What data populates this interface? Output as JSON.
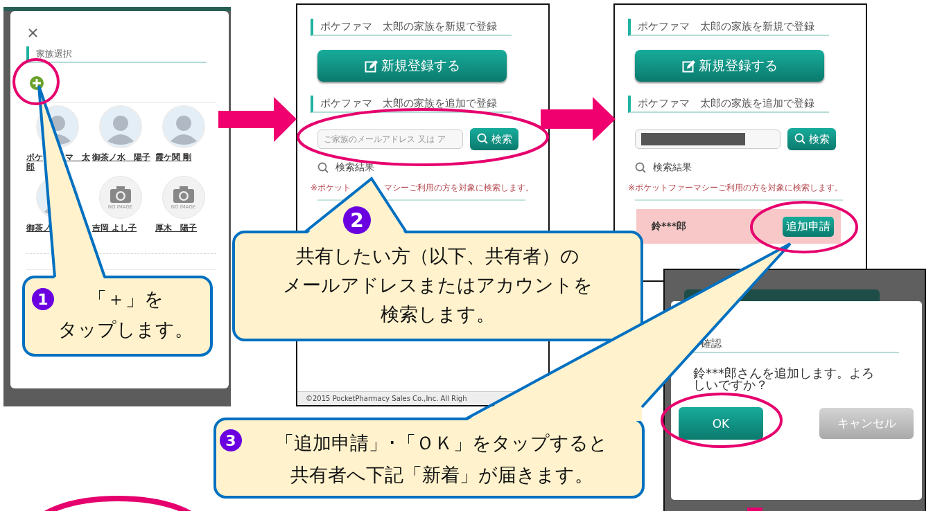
{
  "family_screen": {
    "heading": "家族選択",
    "members": [
      {
        "name_parts": [
          "ポケ",
          "マ　太",
          "郎"
        ],
        "kind": "illustration"
      },
      {
        "name_parts": [
          "御茶ノ水　陽子"
        ],
        "kind": "illustration"
      },
      {
        "name_parts": [
          "霞ケ関 剛"
        ],
        "kind": "illustration"
      },
      {
        "name_parts": [
          "御茶ノ"
        ],
        "kind": "illustration"
      },
      {
        "name_parts": [
          "吉岡 よし子"
        ],
        "kind": "no_image",
        "no_image_label": "NO IMAGE"
      },
      {
        "name_parts": [
          "厚木　陽子"
        ],
        "kind": "no_image",
        "no_image_label": "NO IMAGE"
      }
    ]
  },
  "register_screens": [
    {
      "new_heading": "ポケファマ　太郎の家族を新規で登録",
      "new_button": "新規登録する",
      "add_heading": "ポケファマ　太郎の家族を追加で登録",
      "search_field": {
        "placeholder": "ご家族のメールアドレス 又は ア",
        "redacted": false
      },
      "search_button": "検索",
      "results_heading": "検索結果",
      "note_parts": [
        "※ポケット",
        "マシーご利用の方を対象に検索します。"
      ],
      "footer": "©2015 PocketPharmacy Sales Co.,Inc. All Righ"
    },
    {
      "new_heading": "ポケファマ　太郎の家族を新規で登録",
      "new_button": "新規登録する",
      "add_heading": "ポケファマ　太郎の家族を追加で登録",
      "search_field": {
        "redacted": true
      },
      "search_button": "検索",
      "results_heading": "検索結果",
      "note_parts": [
        "※ポケットファーマシーご利用の方を対象に検索します。"
      ],
      "results": [
        {
          "name": "鈴***郎",
          "button": "追加申請"
        }
      ]
    }
  ],
  "confirm_dialog": {
    "heading": "確認",
    "message": "鈴***郎さんを追加します。よろしいですか？",
    "buttons": [
      {
        "label": "OK",
        "kind": "primary"
      },
      {
        "label": "キャンセル",
        "kind": "secondary"
      }
    ]
  },
  "callouts": [
    {
      "number": "1",
      "lines": [
        "「＋」を",
        "タップします。"
      ]
    },
    {
      "number": "2",
      "lines": [
        "共有したい方（以下、共有者）の",
        "メールアドレスまたはアカウントを",
        "検索します。"
      ]
    },
    {
      "number": "3",
      "lines": [
        "「追加申請」･「ＯＫ」をタップすると",
        "共有者へ下記「新着」が届きます。"
      ]
    }
  ]
}
